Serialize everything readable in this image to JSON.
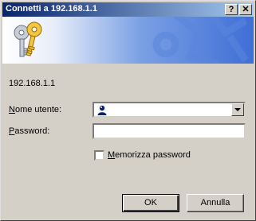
{
  "window": {
    "title": "Connetti a 192.168.1.1"
  },
  "titlebar": {
    "help_label": "?",
    "close_label": "✕"
  },
  "banner": {
    "icon": "keys-icon"
  },
  "main": {
    "host": "192.168.1.1",
    "username_label_underlined": "N",
    "username_label_rest": "ome utente:",
    "username_value": "",
    "password_label_underlined": "P",
    "password_label_rest": "assword:",
    "password_value": "",
    "remember_label_underlined": "M",
    "remember_label_rest": "emorizza password",
    "remember_checked": false
  },
  "buttons": {
    "ok": "OK",
    "cancel": "Annulla"
  },
  "colors": {
    "titlebar_start": "#0a246a",
    "titlebar_end": "#a6caf0",
    "face": "#d4d0c8"
  }
}
